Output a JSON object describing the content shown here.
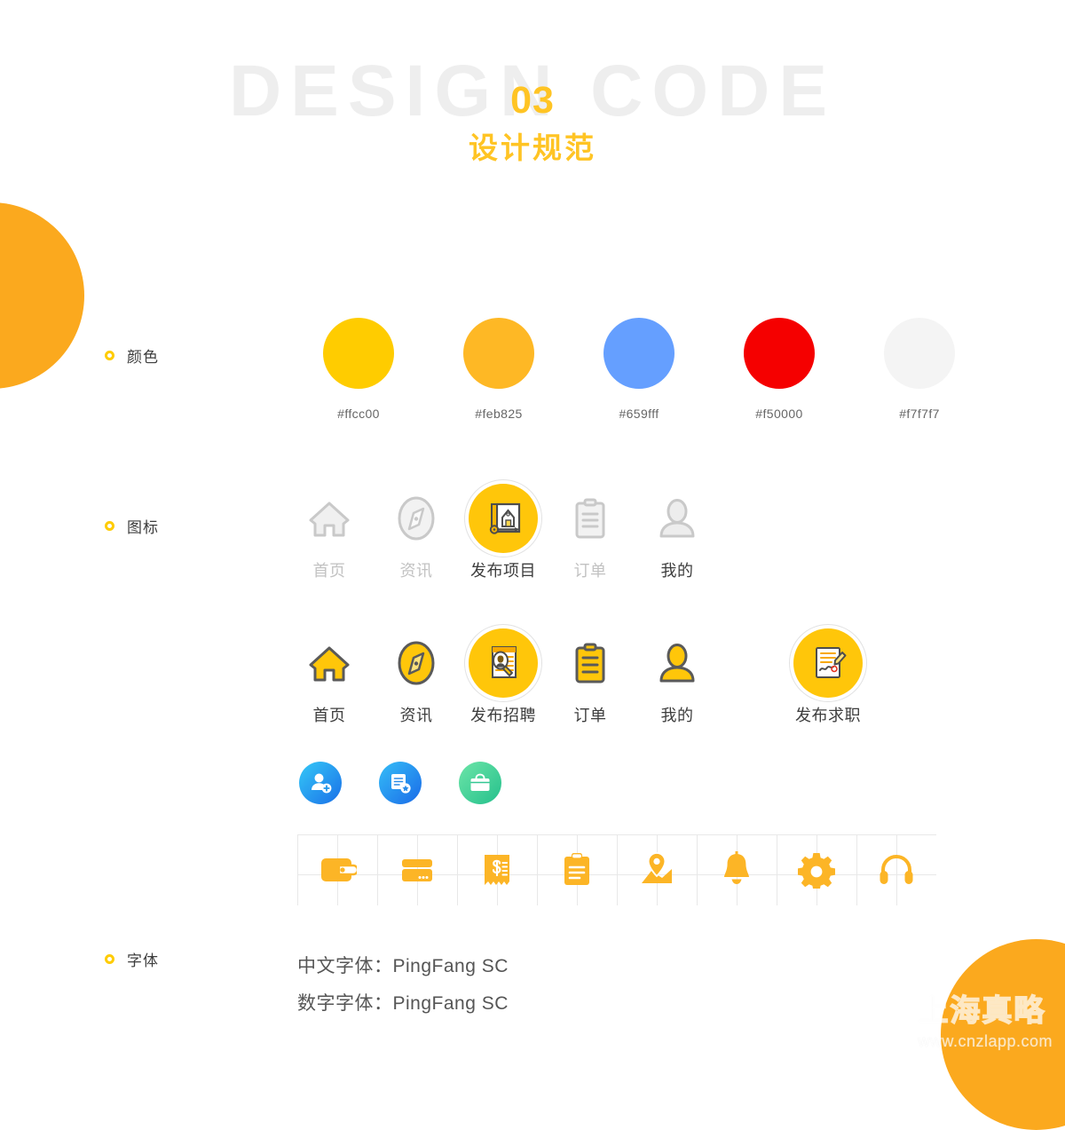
{
  "header": {
    "ghost_title": "DESIGN CODE",
    "number": "03",
    "subtitle": "设计规范"
  },
  "sections": {
    "colors_label": "颜色",
    "icons_label": "图标",
    "fonts_label": "字体"
  },
  "colors": [
    {
      "name": "primary-yellow",
      "hex": "#ffcc00"
    },
    {
      "name": "secondary-orange",
      "hex": "#feb825"
    },
    {
      "name": "accent-blue",
      "hex": "#659fff"
    },
    {
      "name": "alert-red",
      "hex": "#f50000"
    },
    {
      "name": "background-grey",
      "hex": "#f7f7f7"
    }
  ],
  "icon_row_1": [
    {
      "label": "首页",
      "icon": "home-icon",
      "state": "inactive"
    },
    {
      "label": "资讯",
      "icon": "compass-icon",
      "state": "inactive"
    },
    {
      "label": "发布项目",
      "icon": "blueprint-icon",
      "state": "active"
    },
    {
      "label": "订单",
      "icon": "clipboard-icon",
      "state": "inactive"
    },
    {
      "label": "我的",
      "icon": "person-icon",
      "state": "inactive-dark-label"
    }
  ],
  "icon_row_2": [
    {
      "label": "首页",
      "icon": "home-icon",
      "state": "yellow"
    },
    {
      "label": "资讯",
      "icon": "compass-icon",
      "state": "yellow"
    },
    {
      "label": "发布招聘",
      "icon": "resume-search-icon",
      "state": "active"
    },
    {
      "label": "订单",
      "icon": "clipboard-icon",
      "state": "yellow"
    },
    {
      "label": "我的",
      "icon": "person-icon",
      "state": "yellow"
    },
    {
      "label": "发布求职",
      "icon": "signing-icon",
      "state": "active"
    }
  ],
  "round_icons": [
    {
      "name": "add-worker-icon",
      "color_start": "#2fc2f5",
      "color_end": "#1a72e8"
    },
    {
      "name": "document-star-icon",
      "color_start": "#2fb9f5",
      "color_end": "#1a6fe8"
    },
    {
      "name": "briefcase-icon",
      "color_start": "#5fe0a0",
      "color_end": "#2bc48f"
    }
  ],
  "strip_icons": [
    {
      "name": "wallet-icon"
    },
    {
      "name": "credit-card-icon"
    },
    {
      "name": "receipt-icon"
    },
    {
      "name": "clipboard-icon"
    },
    {
      "name": "map-pin-icon"
    },
    {
      "name": "bell-icon"
    },
    {
      "name": "gear-icon"
    },
    {
      "name": "headphones-icon"
    }
  ],
  "fonts": {
    "chinese": "中文字体：PingFang SC",
    "numeric": "数字字体：PingFang SC"
  },
  "watermark": {
    "company": "上海真略",
    "url": "www.cnzlapp.com"
  }
}
